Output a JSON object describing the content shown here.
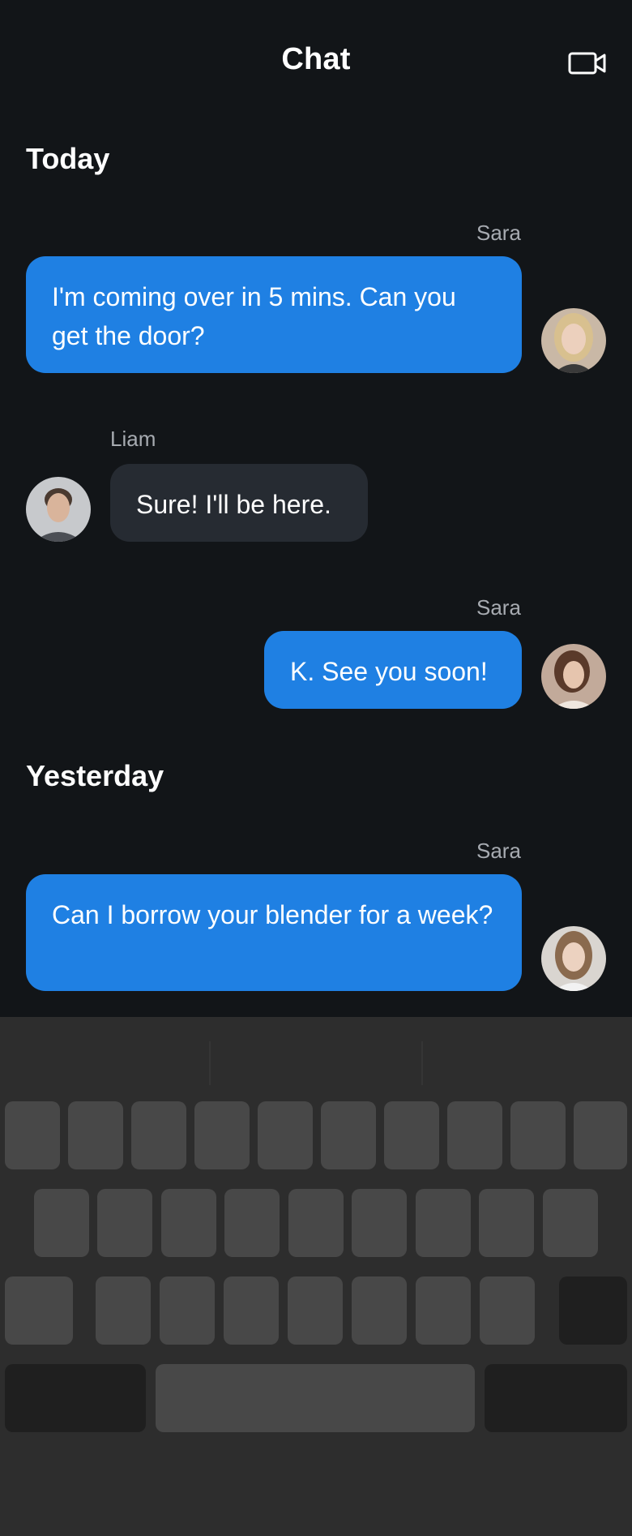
{
  "header": {
    "title": "Chat",
    "video_icon": "video-camera-icon"
  },
  "sections": [
    {
      "label": "Today",
      "messages": [
        {
          "sender": "Sara",
          "text": "I'm coming over in 5 mins. Can you get the door?",
          "side": "right",
          "style": "blue"
        },
        {
          "sender": "Liam",
          "text": "Sure! I'll be here.",
          "side": "left",
          "style": "gray"
        },
        {
          "sender": "Sara",
          "text": "K. See you soon!",
          "side": "right",
          "style": "blue"
        }
      ]
    },
    {
      "label": "Yesterday",
      "messages": [
        {
          "sender": "Sara",
          "text": "Can I borrow your blender for a week?",
          "side": "right",
          "style": "blue"
        }
      ]
    }
  ],
  "colors": {
    "background": "#121518",
    "outgoing_bubble": "#1f80e3",
    "incoming_bubble": "#262b32",
    "sender_name": "#a7abb1",
    "keyboard": "#2d2d2d"
  }
}
